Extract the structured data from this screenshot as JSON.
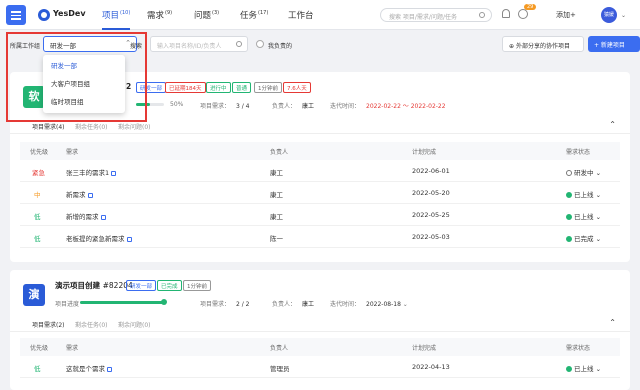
{
  "topbar": {
    "brand": "YesDev",
    "nav": [
      {
        "label": "项目",
        "count": "(10)"
      },
      {
        "label": "需求",
        "count": "(9)"
      },
      {
        "label": "问题",
        "count": "(3)"
      },
      {
        "label": "任务",
        "count": "(17)"
      },
      {
        "label": "工作台",
        "count": ""
      }
    ],
    "search_placeholder": "搜索 项目/需求/问题/任务",
    "notif_badge": "29",
    "add_label": "添加+",
    "avatar_text": "猿媛"
  },
  "filters": {
    "workgroup_label": "所属工作组",
    "workgroup_value": "研发一部",
    "search_label": "搜索",
    "search_placeholder": "输入项目名称/ID/负责人",
    "mine_label": "我负责的",
    "external_button": "外部分享的协作项目",
    "new_button": "+ 新建项目"
  },
  "dropdown": {
    "options": [
      "研发一部",
      "大客户项目组",
      "临时项目组"
    ]
  },
  "projects": [
    {
      "icon_char": "软",
      "icon_color": "#22b573",
      "name_visible": "2",
      "tags": [
        {
          "text": "研发一部",
          "color": "#3b6df0"
        },
        {
          "text": "已延期184天",
          "color": "#e53935"
        },
        {
          "text": "进行中",
          "color": "#22b573"
        },
        {
          "text": "普通",
          "color": "#22b573"
        },
        {
          "text": "1分钟前",
          "color": "#666666"
        },
        {
          "text": "7.6人天",
          "color": "#e53935"
        }
      ],
      "progress_pct": "50%",
      "progress_value": 0.5,
      "req_label": "项目需求：",
      "req_value": "3 / 4",
      "owner_label": "负责人：",
      "owner_value": "康工",
      "iter_label": "迭代时间：",
      "iter_value": "2022-02-22 ～ 2022-02-22",
      "tabs": [
        "项目需求(4)",
        "剩余任务(0)",
        "剩余问题(0)"
      ],
      "headers": [
        "优先级",
        "需求",
        "负责人",
        "计划完成",
        "需求状态"
      ],
      "rows": [
        {
          "prio": "紧急",
          "prio_color": "#e53935",
          "title": "张三丰的需求1",
          "owner": "康工",
          "date": "2022-06-01",
          "status": "研发中",
          "done": false
        },
        {
          "prio": "中",
          "prio_color": "#f59a23",
          "title": "新需求",
          "owner": "康工",
          "date": "2022-05-20",
          "status": "已上线",
          "done": true
        },
        {
          "prio": "低",
          "prio_color": "#22b573",
          "title": "新增的需求",
          "owner": "康工",
          "date": "2022-05-25",
          "status": "已上线",
          "done": true
        },
        {
          "prio": "低",
          "prio_color": "#22b573",
          "title": "老板提的紧急新需求",
          "owner": "陈一",
          "date": "2022-05-03",
          "status": "已完成",
          "done": true
        }
      ]
    },
    {
      "icon_char": "演",
      "icon_color": "#2a5bd7",
      "name": "演示项目创建",
      "id": "#82204",
      "tags": [
        {
          "text": "研发一部",
          "color": "#3b6df0"
        },
        {
          "text": "已完成",
          "color": "#22b573"
        },
        {
          "text": "1分钟前",
          "color": "#666666"
        }
      ],
      "progress_label": "项目进度",
      "progress_value": 1.0,
      "req_label": "项目需求：",
      "req_value": "2 / 2",
      "owner_label": "负责人：",
      "owner_value": "康工",
      "iter_label": "迭代时间：",
      "iter_value": "2022-08-18",
      "tabs": [
        "项目需求(2)",
        "剩余任务(0)",
        "剩余问题(0)"
      ],
      "headers": [
        "优先级",
        "需求",
        "负责人",
        "计划完成",
        "需求状态"
      ],
      "rows": [
        {
          "prio": "低",
          "prio_color": "#22b573",
          "title": "这就是个需求",
          "owner": "管理员",
          "date": "2022-04-13",
          "status": "已上线",
          "done": true
        }
      ]
    }
  ]
}
